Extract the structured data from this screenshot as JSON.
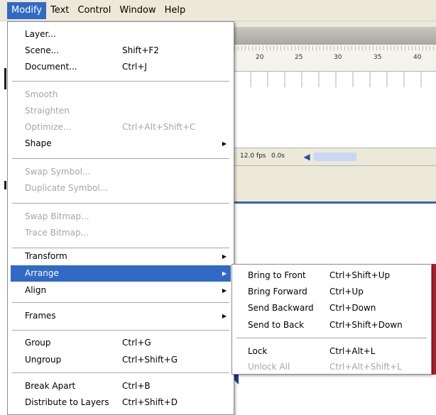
{
  "menubar": {
    "items": [
      "Modify",
      "Text",
      "Control",
      "Window",
      "Help"
    ]
  },
  "timeline": {
    "ruler_ticks": [
      "20",
      "25",
      "30",
      "35",
      "40"
    ],
    "fps": "12.0 fps",
    "time": "0.0s",
    "scroll_left_icon": "chevron-left-icon"
  },
  "modify_menu": {
    "items": [
      {
        "label": "Layer...",
        "shortcut": "",
        "submenu": false,
        "disabled": false
      },
      {
        "label": "Scene...",
        "shortcut": "Shift+F2",
        "submenu": false,
        "disabled": false
      },
      {
        "label": "Document...",
        "shortcut": "Ctrl+J",
        "submenu": false,
        "disabled": false
      },
      {
        "label": "Smooth",
        "shortcut": "",
        "submenu": false,
        "disabled": true
      },
      {
        "label": "Straighten",
        "shortcut": "",
        "submenu": false,
        "disabled": true
      },
      {
        "label": "Optimize...",
        "shortcut": "Ctrl+Alt+Shift+C",
        "submenu": false,
        "disabled": true
      },
      {
        "label": "Shape",
        "shortcut": "",
        "submenu": true,
        "disabled": false
      },
      {
        "label": "Swap Symbol...",
        "shortcut": "",
        "submenu": false,
        "disabled": true
      },
      {
        "label": "Duplicate Symbol...",
        "shortcut": "",
        "submenu": false,
        "disabled": true
      },
      {
        "label": "Swap Bitmap...",
        "shortcut": "",
        "submenu": false,
        "disabled": true
      },
      {
        "label": "Trace Bitmap...",
        "shortcut": "",
        "submenu": false,
        "disabled": true
      },
      {
        "label": "Transform",
        "shortcut": "",
        "submenu": true,
        "disabled": false
      },
      {
        "label": "Arrange",
        "shortcut": "",
        "submenu": true,
        "disabled": false,
        "highlighted": true
      },
      {
        "label": "Align",
        "shortcut": "",
        "submenu": true,
        "disabled": false
      },
      {
        "label": "Frames",
        "shortcut": "",
        "submenu": true,
        "disabled": false
      },
      {
        "label": "Group",
        "shortcut": "Ctrl+G",
        "submenu": false,
        "disabled": false
      },
      {
        "label": "Ungroup",
        "shortcut": "Ctrl+Shift+G",
        "submenu": false,
        "disabled": false
      },
      {
        "label": "Break Apart",
        "shortcut": "Ctrl+B",
        "submenu": false,
        "disabled": false
      },
      {
        "label": "Distribute to Layers",
        "shortcut": "Ctrl+Shift+D",
        "submenu": false,
        "disabled": false
      }
    ],
    "submenu_arrow_icon": "submenu-arrow-icon"
  },
  "arrange_submenu": {
    "items": [
      {
        "label": "Bring to Front",
        "shortcut": "Ctrl+Shift+Up",
        "disabled": false
      },
      {
        "label": "Bring Forward",
        "shortcut": "Ctrl+Up",
        "disabled": false
      },
      {
        "label": "Send Backward",
        "shortcut": "Ctrl+Down",
        "disabled": false
      },
      {
        "label": "Send to Back",
        "shortcut": "Ctrl+Shift+Down",
        "disabled": false
      },
      {
        "label": "Lock",
        "shortcut": "Ctrl+Alt+L",
        "disabled": false
      },
      {
        "label": "Unlock All",
        "shortcut": "Ctrl+Alt+Shift+L",
        "disabled": true
      }
    ]
  },
  "colors": {
    "highlight": "#316ac5",
    "menubar_bg": "#ece9d8",
    "disabled_text": "#a6a6a6"
  }
}
